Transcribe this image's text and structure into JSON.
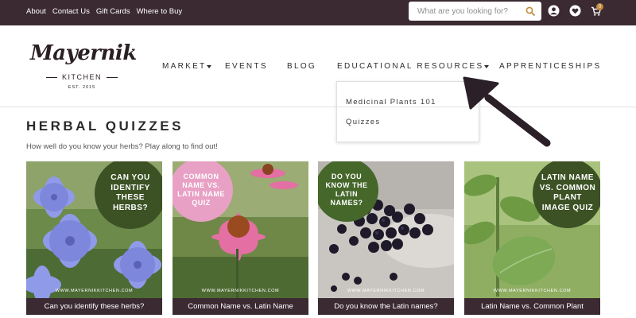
{
  "topbar": {
    "links": [
      "About",
      "Contact Us",
      "Gift Cards",
      "Where to Buy"
    ],
    "search_placeholder": "What are you looking for?",
    "cart_count": "0",
    "icons": [
      "search-icon",
      "account-icon",
      "heart-icon",
      "cart-icon"
    ]
  },
  "logo": {
    "script": "Mayernik",
    "sub": "KITCHEN",
    "est": "EST. 2015"
  },
  "nav": {
    "items": [
      {
        "label": "MARKET",
        "has_dropdown": true
      },
      {
        "label": "EVENTS",
        "has_dropdown": false
      },
      {
        "label": "BLOG",
        "has_dropdown": false
      },
      {
        "label": "EDUCATIONAL RESOURCES",
        "has_dropdown": true
      },
      {
        "label": "APPRENTICESHIPS",
        "has_dropdown": false
      }
    ],
    "dropdown_items": [
      "Medicinal Plants 101",
      "Quizzes"
    ]
  },
  "page": {
    "title": "HERBAL QUIZZES",
    "intro": "How well do you know your herbs? Play along to find out!"
  },
  "cards": [
    {
      "badge": "CAN YOU IDENTIFY THESE HERBS?",
      "caption": "Can you identify these herbs?",
      "watermark": "WWW.MAYERNIKKITCHEN.COM",
      "badge_color": "#3c5224"
    },
    {
      "badge": "COMMON NAME VS. LATIN NAME QUIZ",
      "caption": "Common Name vs. Latin Name",
      "watermark": "WWW.MAYERNIKKITCHEN.COM",
      "badge_color": "#e8a0c4"
    },
    {
      "badge": "DO YOU KNOW THE LATIN NAMES?",
      "caption": "Do you know the Latin names?",
      "watermark": "WWW.MAYERNIKKITCHEN.COM",
      "badge_color": "#45672a"
    },
    {
      "badge": "LATIN NAME VS. COMMON PLANT IMAGE QUIZ",
      "caption": "Latin Name vs. Common Plant",
      "watermark": "WWW.MAYERNIKKITCHEN.COM",
      "badge_color": "#3c5224"
    }
  ],
  "colors": {
    "topbar_bg": "#3b2a32",
    "caption_bg": "#3b2a32",
    "accent_gold": "#c08a3b",
    "annotation_arrow": "#2b2028"
  }
}
